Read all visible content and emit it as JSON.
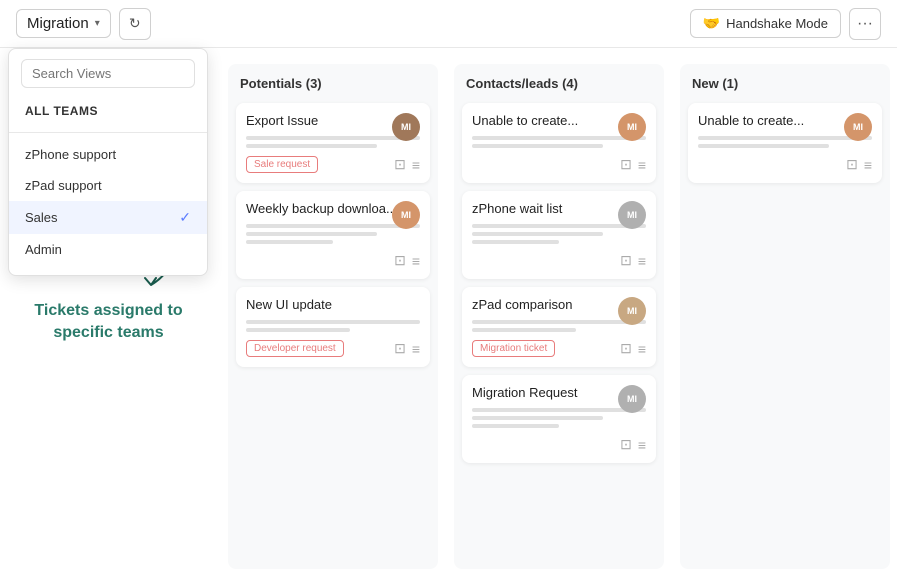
{
  "header": {
    "title": "Migration",
    "chevron": "▾",
    "refresh_icon": "↻",
    "handshake_label": "Handshake Mode",
    "more_icon": "···",
    "handshake_icon": "🤝"
  },
  "dropdown": {
    "search_placeholder": "Search Views",
    "all_teams_label": "ALL TEAMS",
    "items": [
      {
        "label": "zPhone support",
        "active": false
      },
      {
        "label": "zPad support",
        "active": false
      },
      {
        "label": "Sales",
        "active": true
      },
      {
        "label": "Admin",
        "active": false
      }
    ],
    "check_icon": "✓"
  },
  "columns": [
    {
      "id": "potentials",
      "header": "Potentials (3)",
      "cards": [
        {
          "title": "Export Issue",
          "badge": "Sale request",
          "badge_type": "sale",
          "has_avatar": true,
          "avatar_label": "MI",
          "avatar_class": "av-brown"
        },
        {
          "title": "Weekly backup downloa...",
          "badge": null,
          "has_avatar": true,
          "avatar_label": "MI",
          "avatar_class": "av-peach"
        },
        {
          "title": "New UI update",
          "badge": "Developer request",
          "badge_type": "developer",
          "has_avatar": false,
          "avatar_label": "",
          "avatar_class": ""
        }
      ]
    },
    {
      "id": "contacts",
      "header": "Contacts/leads (4)",
      "cards": [
        {
          "title": "Unable to create...",
          "badge": null,
          "has_avatar": true,
          "avatar_label": "MI",
          "avatar_class": "av-peach"
        },
        {
          "title": "zPhone wait list",
          "badge": null,
          "has_avatar": false,
          "avatar_label": "MI",
          "avatar_class": "av-gray"
        },
        {
          "title": "zPad comparison",
          "badge": "Migration ticket",
          "badge_type": "migration",
          "has_avatar": true,
          "avatar_label": "MI",
          "avatar_class": "av-tan"
        },
        {
          "title": "Migration Request",
          "badge": null,
          "has_avatar": false,
          "avatar_label": "MI",
          "avatar_class": "av-gray"
        }
      ]
    },
    {
      "id": "new",
      "header": "New (1)",
      "cards": [
        {
          "title": "Unable to create...",
          "badge": null,
          "has_avatar": true,
          "avatar_label": "MI",
          "avatar_class": "av-peach"
        }
      ]
    }
  ],
  "annotation": {
    "text": "Tickets assigned to specific teams",
    "arrow": "↙"
  }
}
